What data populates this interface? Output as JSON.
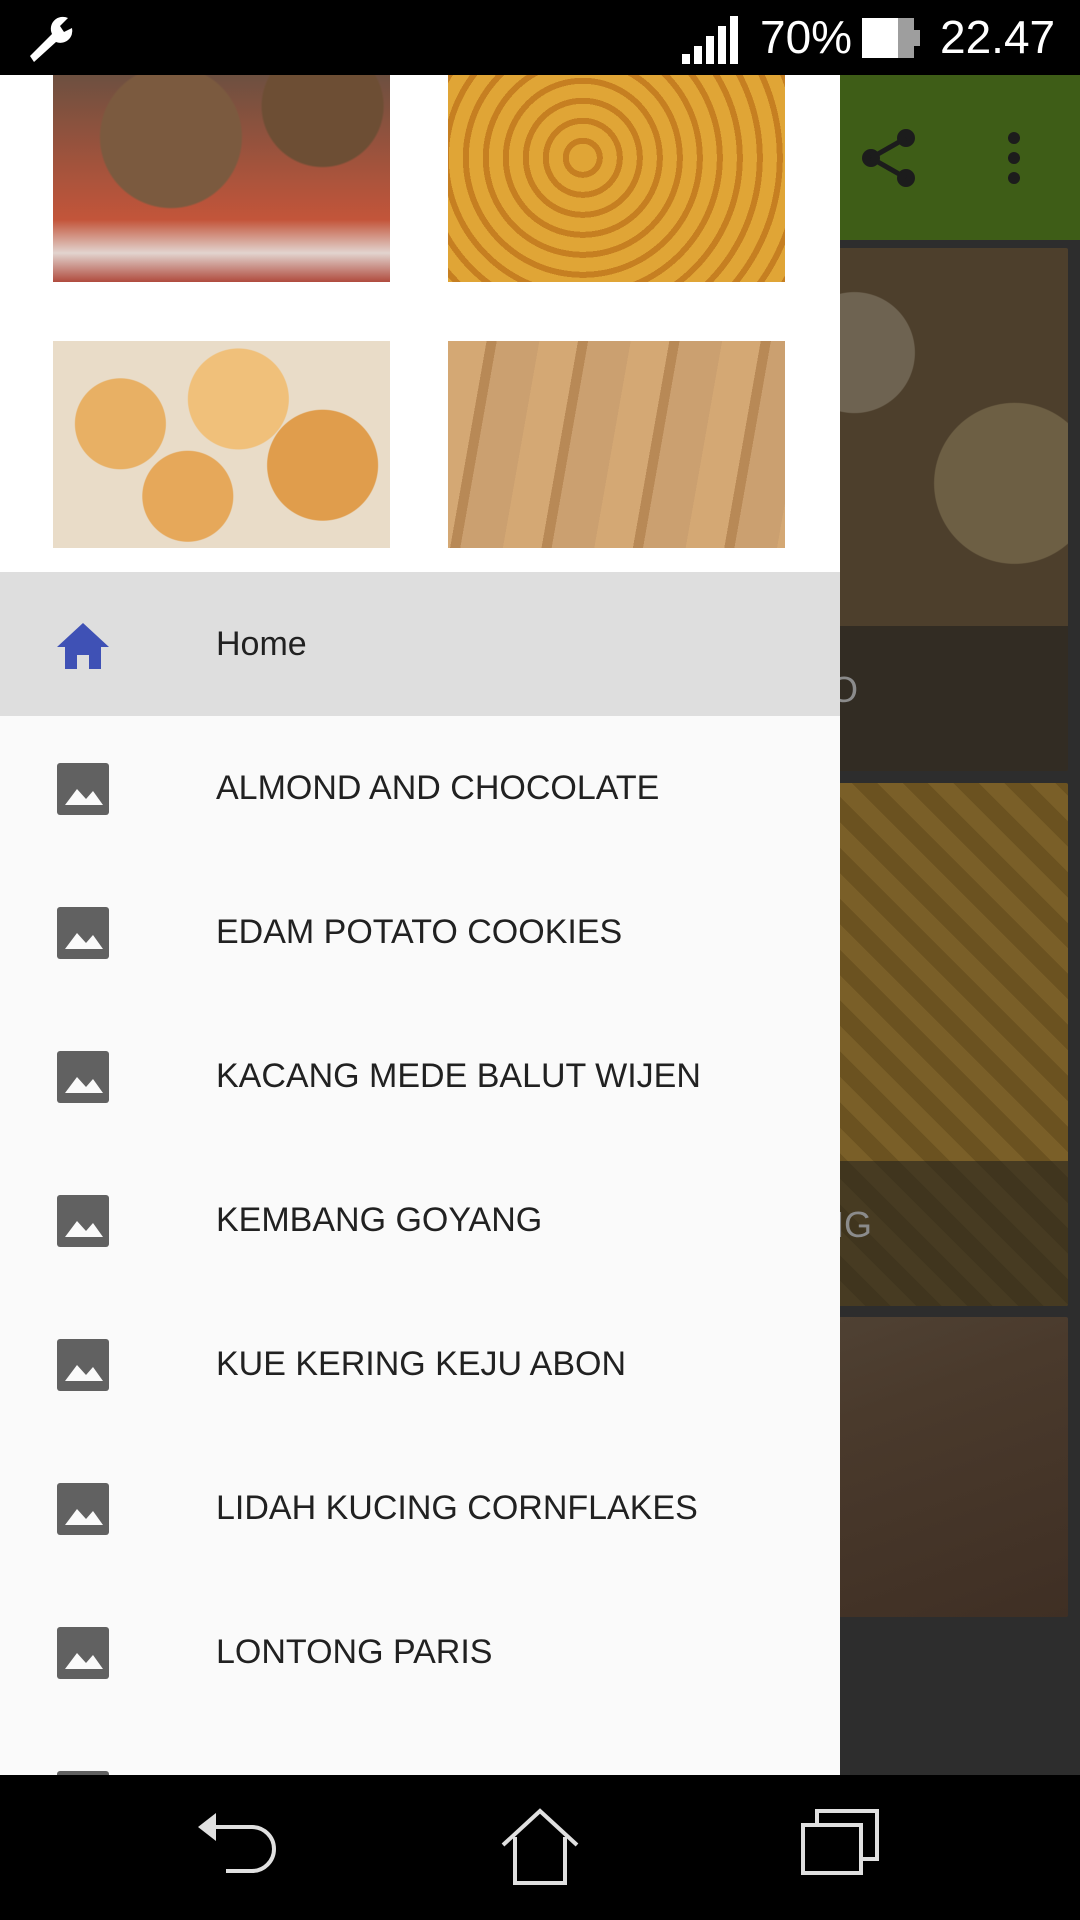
{
  "status_bar": {
    "battery_percent": "70%",
    "time": "22.47",
    "icons": [
      "wrench-icon",
      "signal-icon",
      "battery-icon"
    ]
  },
  "background_app": {
    "toolbar_color": "#548024",
    "toolbar_icons": [
      "share-icon",
      "more-vert-icon"
    ],
    "cards": [
      {
        "title": "TO"
      },
      {
        "title": "OYANG"
      },
      {
        "title": ""
      }
    ]
  },
  "drawer": {
    "header_thumbnails": [
      "cookie-thumbnail",
      "kembang-goyang-thumbnail",
      "coconut-cookie-thumbnail",
      "lidah-kucing-thumbnail"
    ],
    "items": [
      {
        "label": "Home",
        "icon": "home-icon",
        "active": true
      },
      {
        "label": "ALMOND AND CHOCOLATE",
        "icon": "image-icon"
      },
      {
        "label": "EDAM POTATO COOKIES",
        "icon": "image-icon"
      },
      {
        "label": "KACANG MEDE BALUT WIJEN",
        "icon": "image-icon"
      },
      {
        "label": "KEMBANG GOYANG",
        "icon": "image-icon"
      },
      {
        "label": "KUE KERING KEJU ABON",
        "icon": "image-icon"
      },
      {
        "label": "LIDAH KUCING CORNFLAKES",
        "icon": "image-icon"
      },
      {
        "label": "LONTONG PARIS",
        "icon": "image-icon"
      }
    ],
    "accent_color": "#3f51b5",
    "icon_color": "#616161"
  },
  "nav_bar": {
    "buttons": [
      "back-icon",
      "home-nav-icon",
      "recents-icon"
    ]
  }
}
